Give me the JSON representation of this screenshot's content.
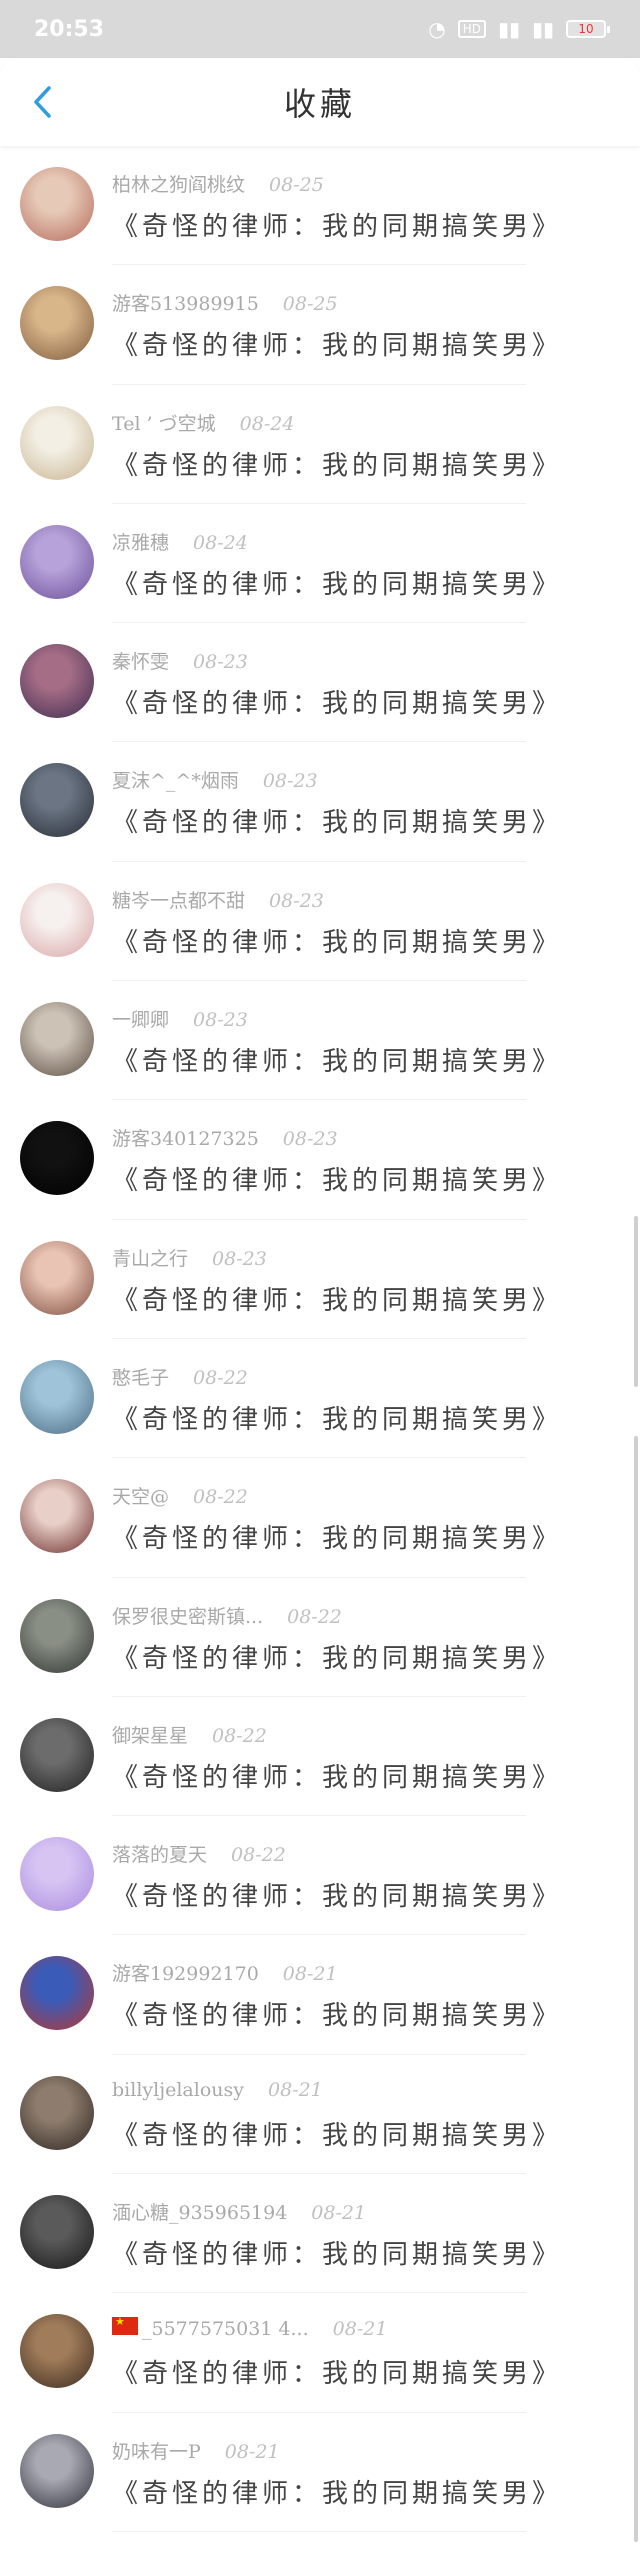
{
  "status_bar": {
    "time": "20:53",
    "wifi_icon": "wifi-icon",
    "hd_label": "HD",
    "signal_label": "4G",
    "signal2_label": "4G",
    "battery_level": "10",
    "battery_color": "#e53935"
  },
  "nav": {
    "back_icon": "chevron-left-icon",
    "title": "收藏",
    "accent": "#2f9de0"
  },
  "items": [
    {
      "name": "柏林之狗阎桃纹",
      "date": "08-25",
      "title": "《奇怪的律师：我的同期搞笑男》",
      "avatar_colors": [
        "#e7c9b7",
        "#b56a5a"
      ],
      "flag": false
    },
    {
      "name": "游客513989915",
      "date": "08-25",
      "title": "《奇怪的律师：我的同期搞笑男》",
      "avatar_colors": [
        "#d9b58a",
        "#7d5b3c"
      ],
      "flag": false
    },
    {
      "name": "Tel ’ づ空城",
      "date": "08-24",
      "title": "《奇怪的律师：我的同期搞笑男》",
      "avatar_colors": [
        "#f3efe4",
        "#c7b38f"
      ],
      "flag": false
    },
    {
      "name": "凉雅穗",
      "date": "08-24",
      "title": "《奇怪的律师：我的同期搞笑男》",
      "avatar_colors": [
        "#b7a2d9",
        "#6a4f9a"
      ],
      "flag": false
    },
    {
      "name": "秦怀雯",
      "date": "08-23",
      "title": "《奇怪的律师：我的同期搞笑男》",
      "avatar_colors": [
        "#a66d86",
        "#3c2b4f"
      ],
      "flag": false
    },
    {
      "name": "夏沫^_^*烟雨",
      "date": "08-23",
      "title": "《奇怪的律师：我的同期搞笑男》",
      "avatar_colors": [
        "#6b7584",
        "#262c34"
      ],
      "flag": false
    },
    {
      "name": "糖岑一点都不甜",
      "date": "08-23",
      "title": "《奇怪的律师：我的同期搞笑男》",
      "avatar_colors": [
        "#f6f0ee",
        "#d9a3a3"
      ],
      "flag": false
    },
    {
      "name": "一卿卿",
      "date": "08-23",
      "title": "《奇怪的律师：我的同期搞笑男》",
      "avatar_colors": [
        "#cdc2b6",
        "#5a4d43"
      ],
      "flag": false
    },
    {
      "name": "游客340127325",
      "date": "08-23",
      "title": "《奇怪的律师：我的同期搞笑男》",
      "avatar_colors": [
        "#111111",
        "#000000"
      ],
      "flag": false
    },
    {
      "name": "青山之行",
      "date": "08-23",
      "title": "《奇怪的律师：我的同期搞笑男》",
      "avatar_colors": [
        "#e9c3b3",
        "#7d4d3f"
      ],
      "flag": false
    },
    {
      "name": "憨毛子",
      "date": "08-22",
      "title": "《奇怪的律师：我的同期搞笑男》",
      "avatar_colors": [
        "#9fc4d9",
        "#4a6b82"
      ],
      "flag": false
    },
    {
      "name": "天空@",
      "date": "08-22",
      "title": "《奇怪的律师：我的同期搞笑男》",
      "avatar_colors": [
        "#e8cfc7",
        "#6b2a2a"
      ],
      "flag": false
    },
    {
      "name": "保罗很史密斯镇...",
      "date": "08-22",
      "title": "《奇怪的律师：我的同期搞笑男》",
      "avatar_colors": [
        "#8a8f86",
        "#2f3530"
      ],
      "flag": false
    },
    {
      "name": "御架星星",
      "date": "08-22",
      "title": "《奇怪的律师：我的同期搞笑男》",
      "avatar_colors": [
        "#6c6c6c",
        "#1f1f1f"
      ],
      "flag": false
    },
    {
      "name": "落落的夏天",
      "date": "08-22",
      "title": "《奇怪的律师：我的同期搞笑男》",
      "avatar_colors": [
        "#d7c4f3",
        "#a98be0"
      ],
      "flag": false
    },
    {
      "name": "游客192992170",
      "date": "08-21",
      "title": "《奇怪的律师：我的同期搞笑男》",
      "avatar_colors": [
        "#3b5bb8",
        "#b8372f"
      ],
      "flag": false
    },
    {
      "name": "billyljelalousy",
      "date": "08-21",
      "title": "《奇怪的律师：我的同期搞笑男》",
      "avatar_colors": [
        "#8e7d6e",
        "#2d241f"
      ],
      "flag": false
    },
    {
      "name": "湎心糖_935965194",
      "date": "08-21",
      "title": "《奇怪的律师：我的同期搞笑男》",
      "avatar_colors": [
        "#5a5a5a",
        "#151515"
      ],
      "flag": false
    },
    {
      "name": "_5577575031 4...",
      "date": "08-21",
      "title": "《奇怪的律师：我的同期搞笑男》",
      "avatar_colors": [
        "#a07c5a",
        "#3b2a1e"
      ],
      "flag": true
    },
    {
      "name": "奶味有一P",
      "date": "08-21",
      "title": "《奇怪的律师：我的同期搞笑男》",
      "avatar_colors": [
        "#a9a9b3",
        "#2e2e38"
      ],
      "flag": false
    }
  ],
  "scroll": {
    "thumb1_start": 0.442,
    "thumb1_end": 0.513,
    "thumb2_start": 0.533,
    "thumb2_end": 0.99
  }
}
